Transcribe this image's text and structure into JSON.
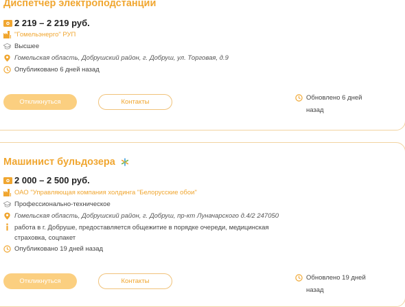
{
  "colors": {
    "accent": "#f0a630",
    "button_fill": "#fbcf80",
    "border": "#f2d3a0"
  },
  "vacancies": [
    {
      "title": "Диспетчер электроподстанции",
      "salary": "2 219 – 2 219 руб.",
      "company": "\"Гомельэнерго\" РУП",
      "education": "Высшее",
      "address": "Гомельская область, Добрушский район, г. Добруш, ул. Торговая, д.9",
      "published": "Опубликовано 6 дней назад",
      "apply_label": "Откликнуться",
      "contacts_label": "Контакты",
      "updated": "Обновлено 6 дней назад"
    },
    {
      "title": "Машинист бульдозера",
      "salary": "2 000 – 2 500 руб.",
      "company": "ОАО \"Управляющая компания холдинга \"Белорусские обои\"",
      "education": "Профессионально-техническое",
      "address": "Гомельская область, Добрушский район, г. Добруш, пр-кт Луначарского д.4/2 247050",
      "info": "работа в г. Добруше, предоставляется общежитие в порядке очереди, медицинская страховка, соцпакет",
      "published": "Опубликовано 19 дней назад",
      "apply_label": "Откликнуться",
      "contacts_label": "Контакты",
      "updated": "Обновлено 19 дней назад"
    }
  ],
  "icons": [
    "money-icon",
    "company-icon",
    "education-icon",
    "location-icon",
    "clock-icon",
    "info-icon",
    "star-badge-icon"
  ]
}
